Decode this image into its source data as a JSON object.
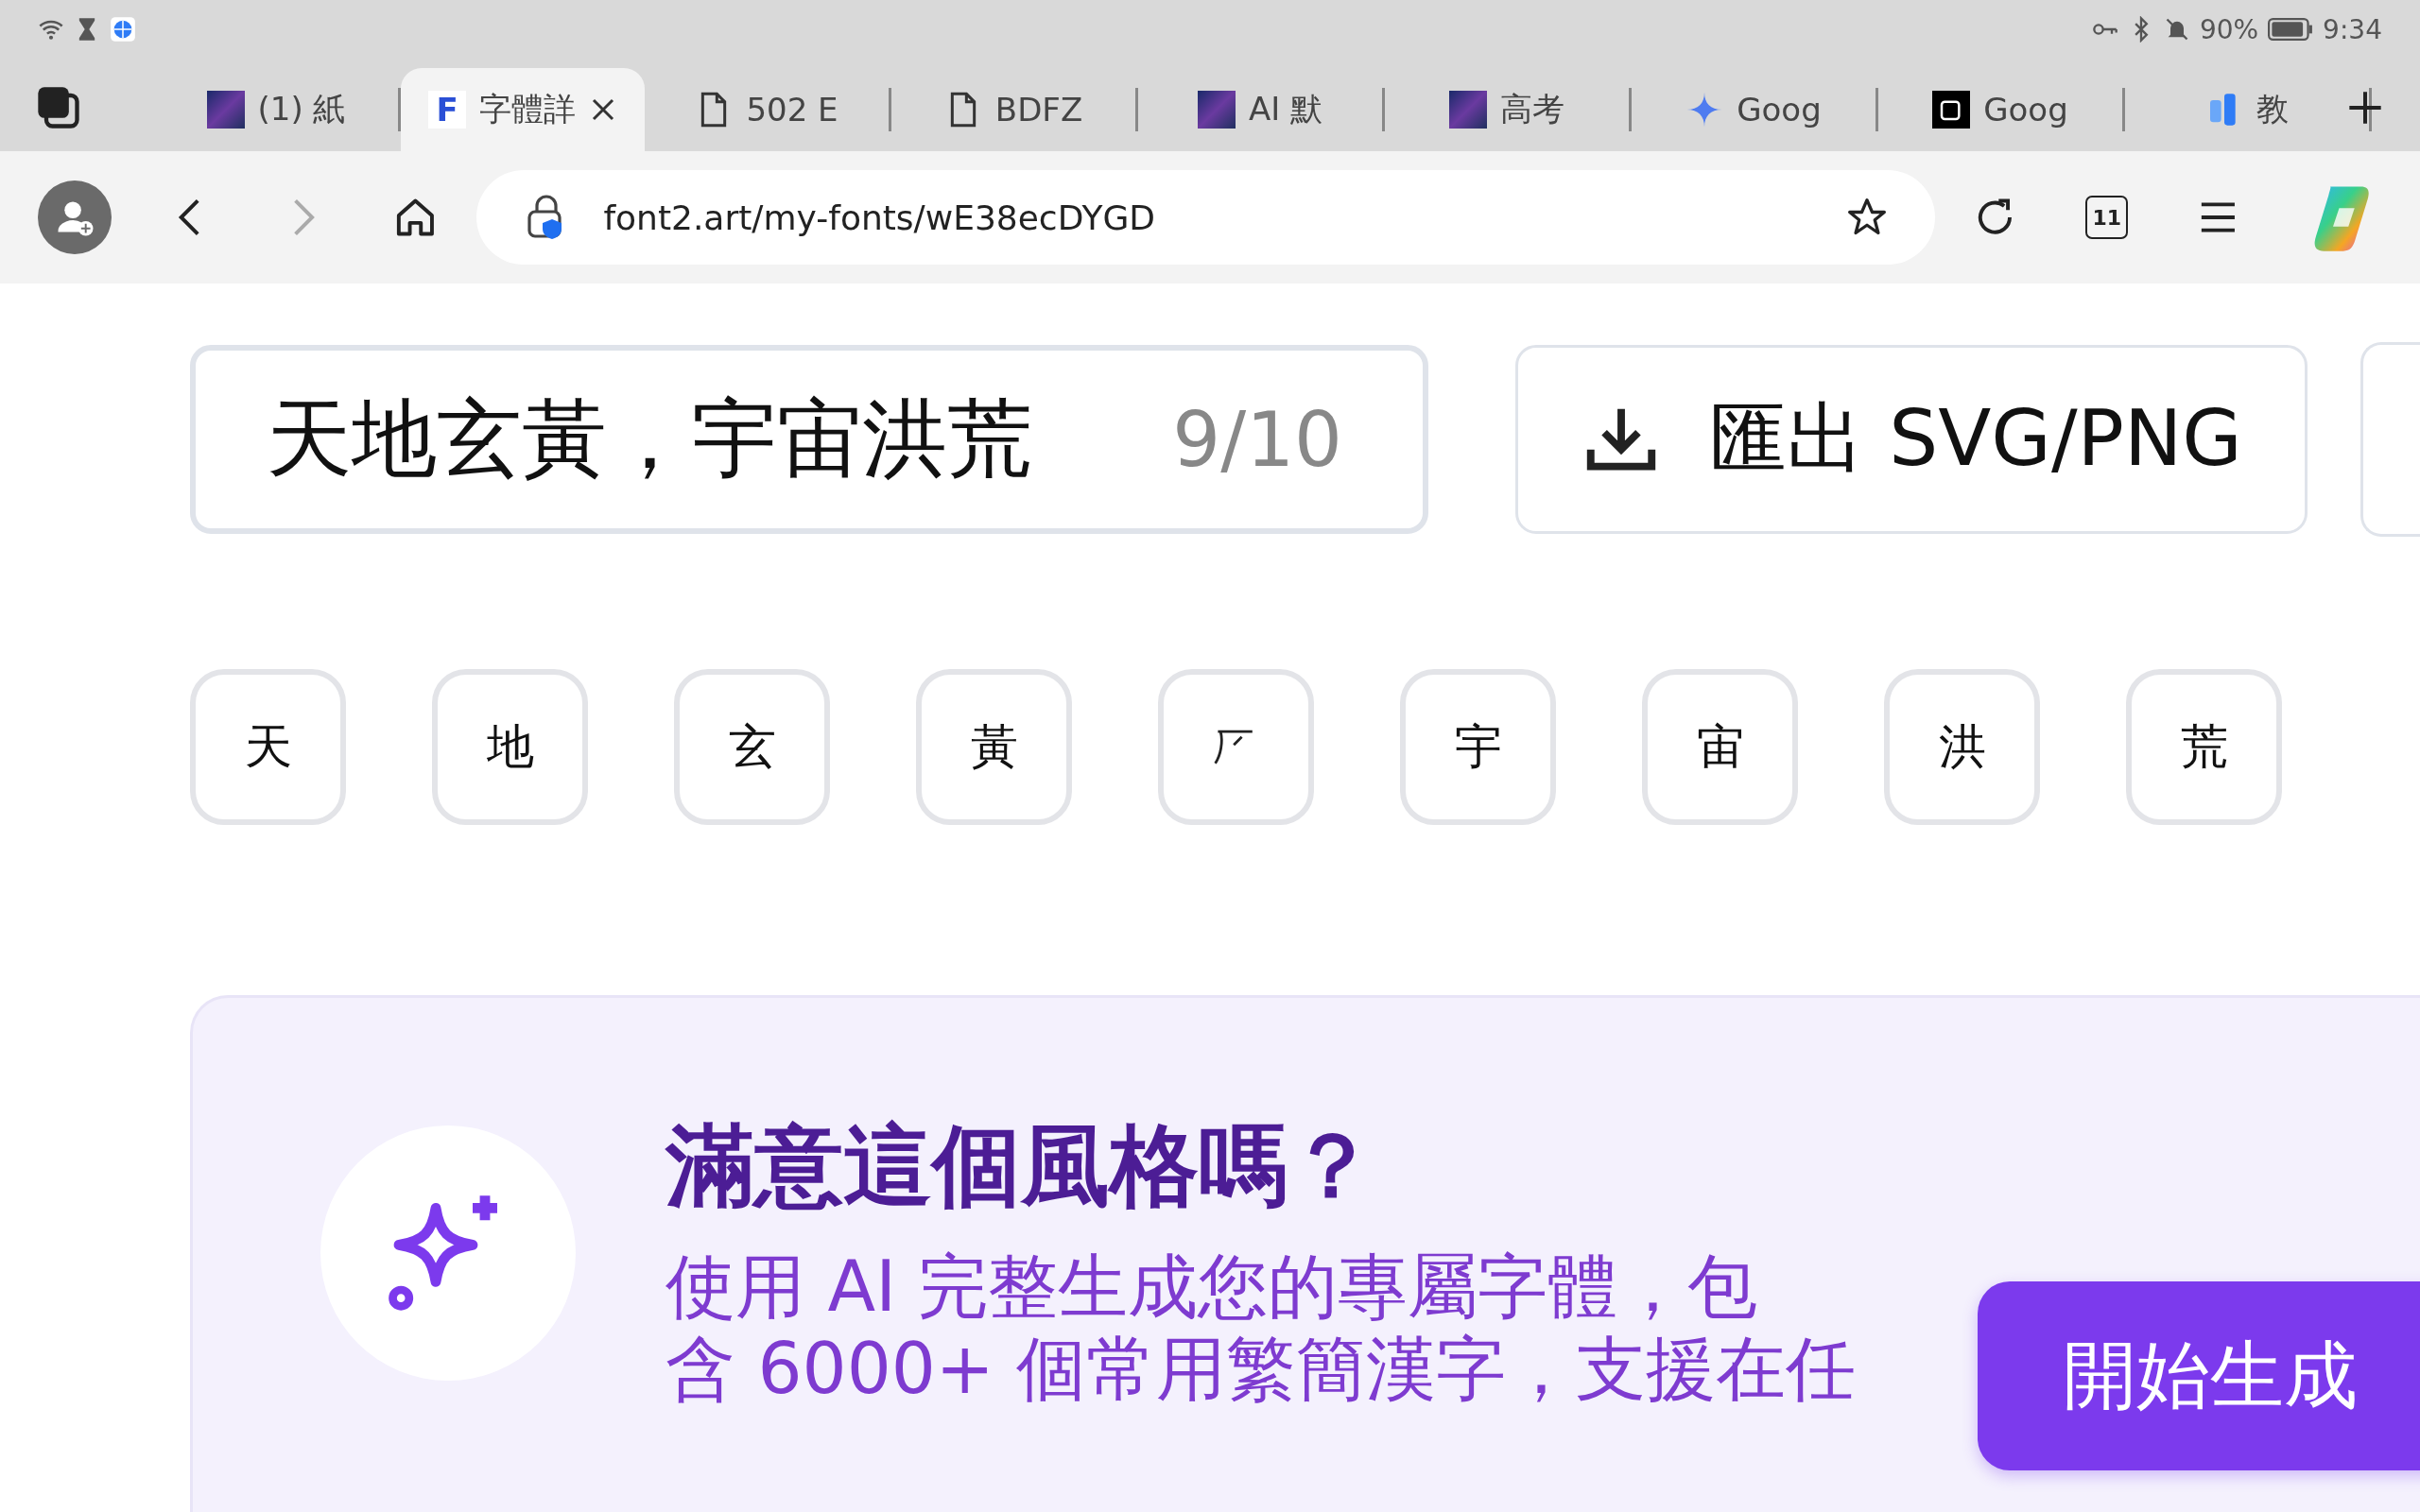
{
  "status_bar": {
    "battery": "90%",
    "time": "9:34"
  },
  "tabs": [
    {
      "kind": "image",
      "label": "(1) 紙",
      "selected": false
    },
    {
      "kind": "letter",
      "icon_text": "F",
      "label": "字體詳",
      "selected": true
    },
    {
      "kind": "page",
      "label": "502 E",
      "selected": false
    },
    {
      "kind": "page",
      "label": "BDFZ",
      "selected": false
    },
    {
      "kind": "image",
      "label": "AI 默",
      "selected": false
    },
    {
      "kind": "image",
      "label": "高考",
      "selected": false
    },
    {
      "kind": "sparkle",
      "label": "Goog",
      "selected": false
    },
    {
      "kind": "dark",
      "label": "Goog",
      "selected": false
    },
    {
      "kind": "bars",
      "label": "教",
      "selected": false
    }
  ],
  "toolbar": {
    "url": "font2.art/my-fonts/wE38ecDYGD",
    "tab_count": "11"
  },
  "text_input": {
    "value": "天地玄黃，宇宙洪荒",
    "counter": "9/10"
  },
  "export_button": "匯出 SVG/PNG",
  "glyphs": [
    {
      "kind": "char",
      "char": "天"
    },
    {
      "kind": "char",
      "char": "地"
    },
    {
      "kind": "char",
      "char": "玄"
    },
    {
      "kind": "char",
      "char": "黃"
    },
    {
      "kind": "broken"
    },
    {
      "kind": "char",
      "char": "宇"
    },
    {
      "kind": "char",
      "char": "宙"
    },
    {
      "kind": "char",
      "char": "洪"
    },
    {
      "kind": "char",
      "char": "荒"
    }
  ],
  "promo": {
    "title": "滿意這個風格嗎？",
    "description_lines": [
      "使用 AI 完整生成您的專屬字體，包",
      "含 6000+ 個常用繁簡漢字，支援在任"
    ],
    "button": "開始生成"
  }
}
